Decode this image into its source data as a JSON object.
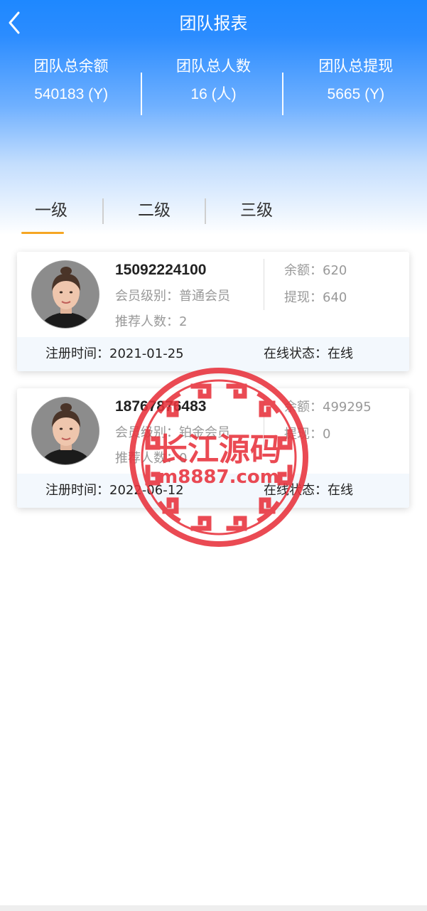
{
  "nav": {
    "title": "团队报表",
    "back_icon": "chevron-left-icon"
  },
  "stats": [
    {
      "label": "团队总余额",
      "value": "540183 (Y)"
    },
    {
      "label": "团队总人数",
      "value": "16 (人)"
    },
    {
      "label": "团队总提现",
      "value": "5665 (Y)"
    }
  ],
  "tabs": [
    {
      "label": "一级",
      "active": true
    },
    {
      "label": "二级",
      "active": false
    },
    {
      "label": "三级",
      "active": false
    }
  ],
  "colors": {
    "accent": "#f5a623",
    "header_blue": "#1e88ff",
    "watermark_red": "#e8323c"
  },
  "members": [
    {
      "phone": "15092224100",
      "level": "会员级别：普通会员",
      "referrals": "推荐人数：2",
      "balance": "余额：620",
      "withdraw": "提现：640",
      "register": "注册时间：2021-01-25",
      "status": "在线状态：在线"
    },
    {
      "phone": "18767876483",
      "level": "会员级别：铂金会员",
      "referrals": "推荐人数：0",
      "balance": "余额：499295",
      "withdraw": "提现：0",
      "register": "注册时间：2022-06-12",
      "status": "在线状态：在线"
    }
  ],
  "watermark": {
    "title": "长江源码",
    "url": "m8887.com"
  }
}
